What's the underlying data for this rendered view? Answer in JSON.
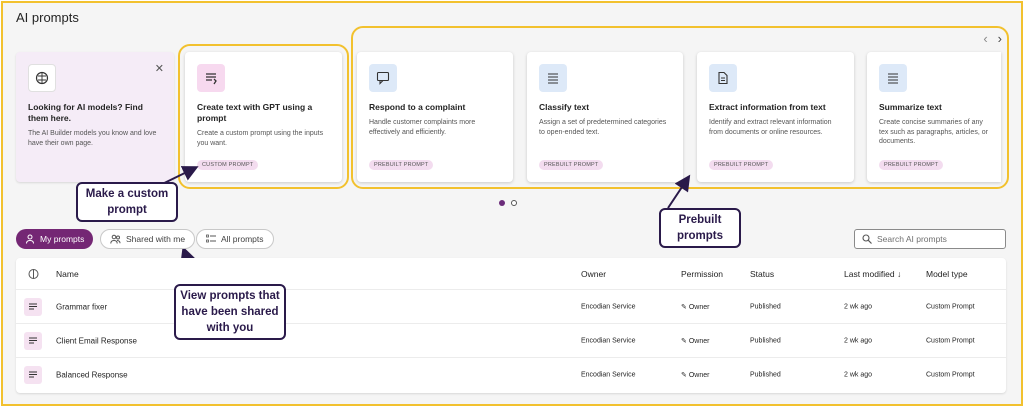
{
  "page": {
    "title": "AI prompts"
  },
  "info_card": {
    "title": "Looking for AI models? Find them here.",
    "description": "The AI Builder models you know and love have their own page."
  },
  "custom_card": {
    "title": "Create text with GPT using a prompt",
    "description": "Create a custom prompt using the inputs you want.",
    "badge": "CUSTOM PROMPT"
  },
  "prebuilt_cards": [
    {
      "title": "Respond to a complaint",
      "description": "Handle customer complaints more effectively and efficiently.",
      "badge": "PREBUILT PROMPT",
      "icon": "chat-icon"
    },
    {
      "title": "Classify text",
      "description": "Assign a set of predetermined categories to open-ended text.",
      "badge": "PREBUILT PROMPT",
      "icon": "list-icon"
    },
    {
      "title": "Extract information from text",
      "description": "Identify and extract relevant information from documents or online resources.",
      "badge": "PREBUILT PROMPT",
      "icon": "document-icon"
    },
    {
      "title": "Summarize text",
      "description": "Create concise summaries of any tex such as paragraphs, articles, or documents.",
      "badge": "PREBUILT PROMPT",
      "icon": "list-icon"
    }
  ],
  "callouts": {
    "custom": "Make a custom prompt",
    "prebuilt": "Prebuilt prompts",
    "shared": "View prompts that have been shared with you"
  },
  "tabs": [
    {
      "label": "My prompts",
      "active": true
    },
    {
      "label": "Shared with me",
      "active": false
    },
    {
      "label": "All prompts",
      "active": false
    }
  ],
  "search": {
    "placeholder": "Search AI prompts"
  },
  "table": {
    "headers": {
      "name": "Name",
      "owner": "Owner",
      "permission": "Permission",
      "status": "Status",
      "last_modified": "Last modified",
      "sort_glyph": "↓",
      "model_type": "Model type"
    },
    "rows": [
      {
        "name": "Grammar fixer",
        "owner": "Encodian Service",
        "permission": "Owner",
        "status": "Published",
        "last_modified": "2 wk ago",
        "model_type": "Custom Prompt"
      },
      {
        "name": "Client Email Response",
        "owner": "Encodian Service",
        "permission": "Owner",
        "status": "Published",
        "last_modified": "2 wk ago",
        "model_type": "Custom Prompt"
      },
      {
        "name": "Balanced Response",
        "owner": "Encodian Service",
        "permission": "Owner",
        "status": "Published",
        "last_modified": "2 wk ago",
        "model_type": "Custom Prompt"
      }
    ]
  },
  "colors": {
    "accent": "#742774",
    "highlight": "#f2c12e",
    "callout_border": "#2a1a4a"
  }
}
